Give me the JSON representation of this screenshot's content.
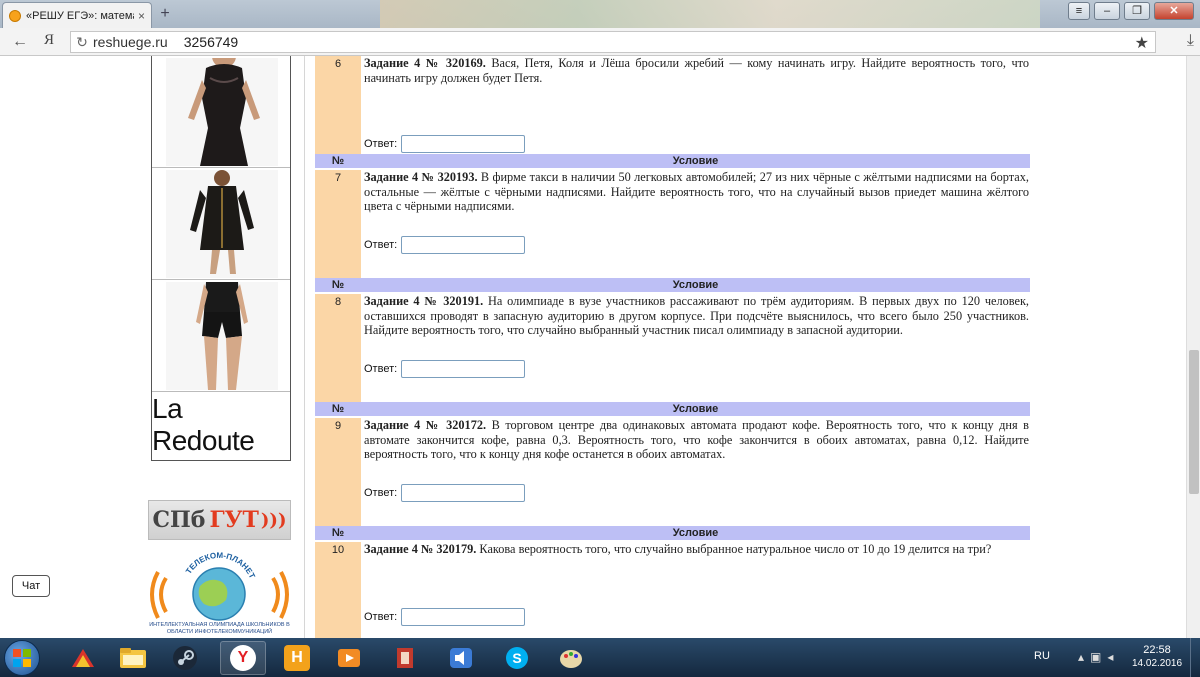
{
  "browser": {
    "tab_title": "«РЕШУ ЕГЭ»: математ",
    "tab_close": "×",
    "new_tab": "+",
    "yandex_btn": "Я",
    "domain": "reshuege.ru",
    "query": "3256749",
    "back": "←",
    "reload": "↻",
    "star": "★",
    "download": "⤓",
    "win_menu": "≡",
    "win_min": "–",
    "win_max": "❐",
    "win_close": "✕"
  },
  "sidebar": {
    "brand": "La Redoute",
    "spb": "СПб",
    "spb_accent": "ГУТ",
    "spb_waves": ")))",
    "telecom_arc": "ТЕЛЕКОМ-ПЛАНЕТА",
    "telecom_caption": "ИНТЕЛЛЕКТУАЛЬНАЯ ОЛИМПИАДА ШКОЛЬНИКОВ В ОБЛАСТИ ИНФОТЕЛЕКОММУНИКАЦИЙ",
    "chat": "Чат"
  },
  "table_headers": {
    "num": "№",
    "condition": "Условие"
  },
  "answer_label": "Ответ:",
  "tasks": [
    {
      "num": "6",
      "title": "Задание 4 № 320169.",
      "text": " Вася, Петя, Коля и Лёша бросили жребий — кому начинать игру. Найдите вероятность того, что начинать игру должен будет Петя."
    },
    {
      "num": "7",
      "title": "Задание 4 № 320193.",
      "text": " В фирме такси в наличии 50 легковых автомобилей; 27 из них чёрные с жёлтыми надписями на бортах, остальные — жёлтые с чёрными надписями. Найдите вероятность того, что на случайный вызов приедет машина жёлтого цвета с чёрными надписями."
    },
    {
      "num": "8",
      "title": "Задание 4 № 320191.",
      "text": " На олимпиаде в вузе участников рассаживают по трём аудиториям. В первых двух по 120 человек, оставшихся проводят в запасную аудиторию в другом корпусе. При подсчёте выяснилось, что всего было 250 участников. Найдите вероятность того, что случайно выбранный участник писал олимпиаду в запасной аудитории."
    },
    {
      "num": "9",
      "title": "Задание 4 № 320172.",
      "text": " В торговом центре два одинаковых автомата продают кофе. Вероятность того, что к концу дня в автомате закончится кофе, равна 0,3. Вероятность того, что кофе закончится в обоих автоматах, равна 0,12. Найдите вероятность того, что к концу дня кофе останется в обоих автоматах."
    },
    {
      "num": "10",
      "title": "Задание 4 № 320179.",
      "text": " Какова вероятность того, что случайно выбранное натуральное число от 10 до 19 делится на три?"
    }
  ],
  "taskbar": {
    "lang": "RU",
    "time": "22:58",
    "date": "14.02.2016",
    "yandex_letter": "Y",
    "h_letter": "H"
  }
}
